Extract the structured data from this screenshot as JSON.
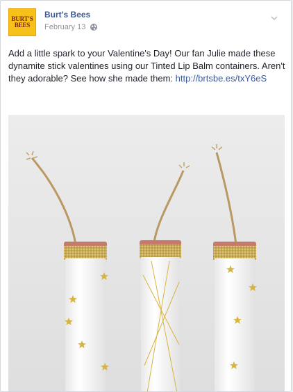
{
  "post": {
    "author_name": "Burt's Bees",
    "date": "February 13",
    "logo": {
      "line1": "BURT'S",
      "line2": "BEES"
    },
    "text": "Add a little spark to your Valentine's Day! Our fan Julie made these dynamite stick valentines using our Tinted Lip Balm containers. Aren't they adorable? See how she made them: ",
    "link": "http://brtsbe.es/txY6eS",
    "icons": {
      "privacy": "globe-icon",
      "options": "chevron-down-icon"
    }
  },
  "colors": {
    "link": "#3b5998",
    "logo_bg": "#f6c21a",
    "logo_text": "#7a1f16"
  }
}
